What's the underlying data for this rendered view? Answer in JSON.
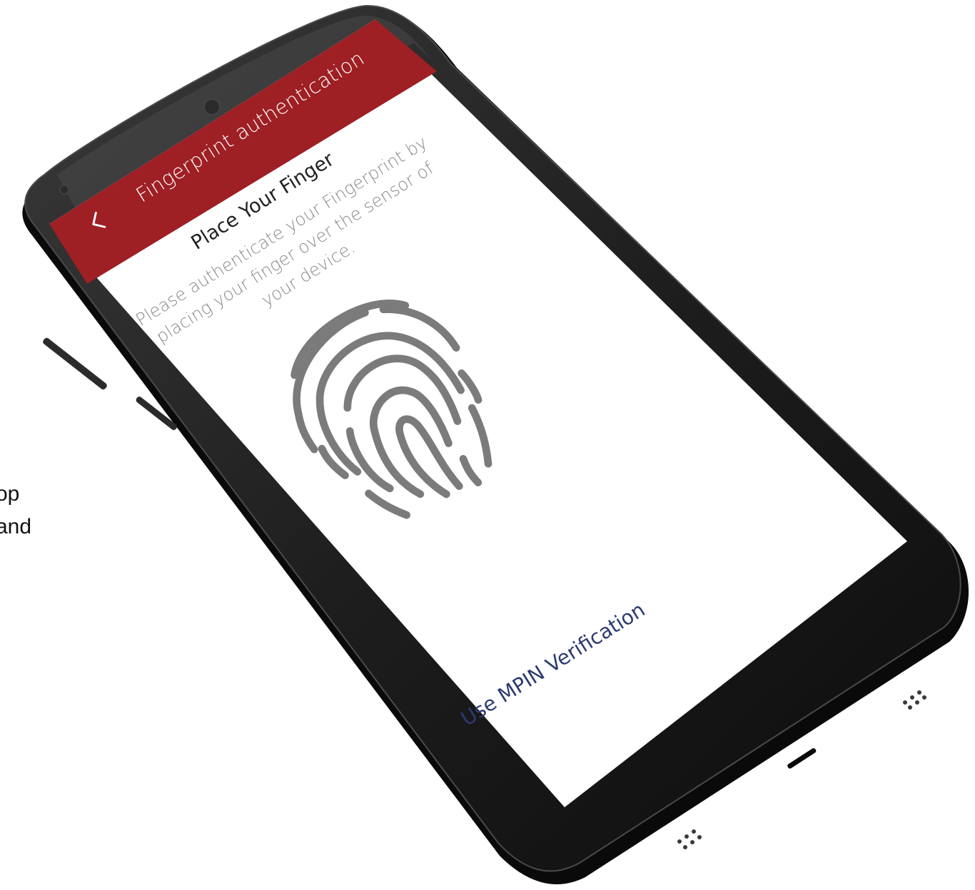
{
  "colors": {
    "accent": "#9e1f24",
    "screen_bg": "#ffffff",
    "fingerprint": "#7b7b7b",
    "link": "#2c3a72",
    "phone_body": "#1a1a1a"
  },
  "side_text": {
    "line1": "op",
    "line2": "and"
  },
  "app_bar": {
    "title": "Fingerprint authentication",
    "back_icon": "chevron-left-icon"
  },
  "content": {
    "heading": "Place Your Finger",
    "instructions": [
      "Please authenticate your Fingerprint by",
      "placing your finger over the sensor of",
      "your device."
    ],
    "fingerprint_icon": "fingerprint-icon"
  },
  "footer": {
    "mpin_link": "Use MPIN Verification"
  }
}
